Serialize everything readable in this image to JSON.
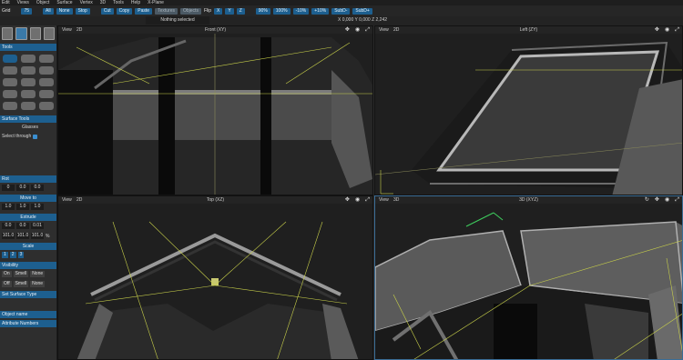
{
  "menu": [
    "Edit",
    "Views",
    "Object",
    "Surface",
    "Vertex",
    "3D",
    "Tools",
    "Help",
    "X-Plane"
  ],
  "toolbar": {
    "grid_label": "Grid",
    "buttons": [
      "All",
      "None",
      "Stop",
      "Cut",
      "Copy",
      "Paste",
      "Textures",
      "Objects"
    ],
    "flip_label": "Flip",
    "buttons2": [
      "90%",
      "100%",
      "-10%",
      "+10%",
      "SubD-",
      "SubD+"
    ]
  },
  "status": {
    "message": "Nothing selected",
    "coords": "X 0,000  Y 0,000  Z 2,242"
  },
  "sidebar": {
    "tool_title": "Tools",
    "section_surface_tools": "Surface Tools",
    "glass_label": "Glasses",
    "select_through": "Select through",
    "section_rot": "Rot",
    "rot": [
      "0",
      "0.0",
      "0.0"
    ],
    "section_move": "Move to",
    "move": [
      "1.0",
      "1.0",
      "1.0"
    ],
    "section_extrude": "Extrude",
    "extrude": [
      "0.0",
      "0.0",
      "0.01"
    ],
    "pct": [
      "101.0",
      "101.0",
      "101.0"
    ],
    "pct_suffix": "%",
    "section_scale": "Scale",
    "scale_buttons": [
      "1",
      "2",
      "3"
    ],
    "section_visibility": "Visibility",
    "vis_row": [
      "On",
      "Smell",
      "None"
    ],
    "vis_row2": [
      "Off",
      "Smell",
      "None"
    ],
    "section_set_surface": "Set Surface Type",
    "section_object_name": "Object name",
    "section_attribute": "Attribute Numbers"
  },
  "viewports": [
    {
      "view": "View",
      "dim": "2D",
      "title": "Front (XY)"
    },
    {
      "view": "View",
      "dim": "2D",
      "title": "Left (ZY)"
    },
    {
      "view": "View",
      "dim": "2D",
      "title": "Top (XZ)"
    },
    {
      "view": "View",
      "dim": "3D",
      "title": "3D (XYZ)"
    }
  ],
  "colors": {
    "accent": "#1d5f8f",
    "guide": "#c8d04a",
    "bg": "#1f1f1f"
  }
}
